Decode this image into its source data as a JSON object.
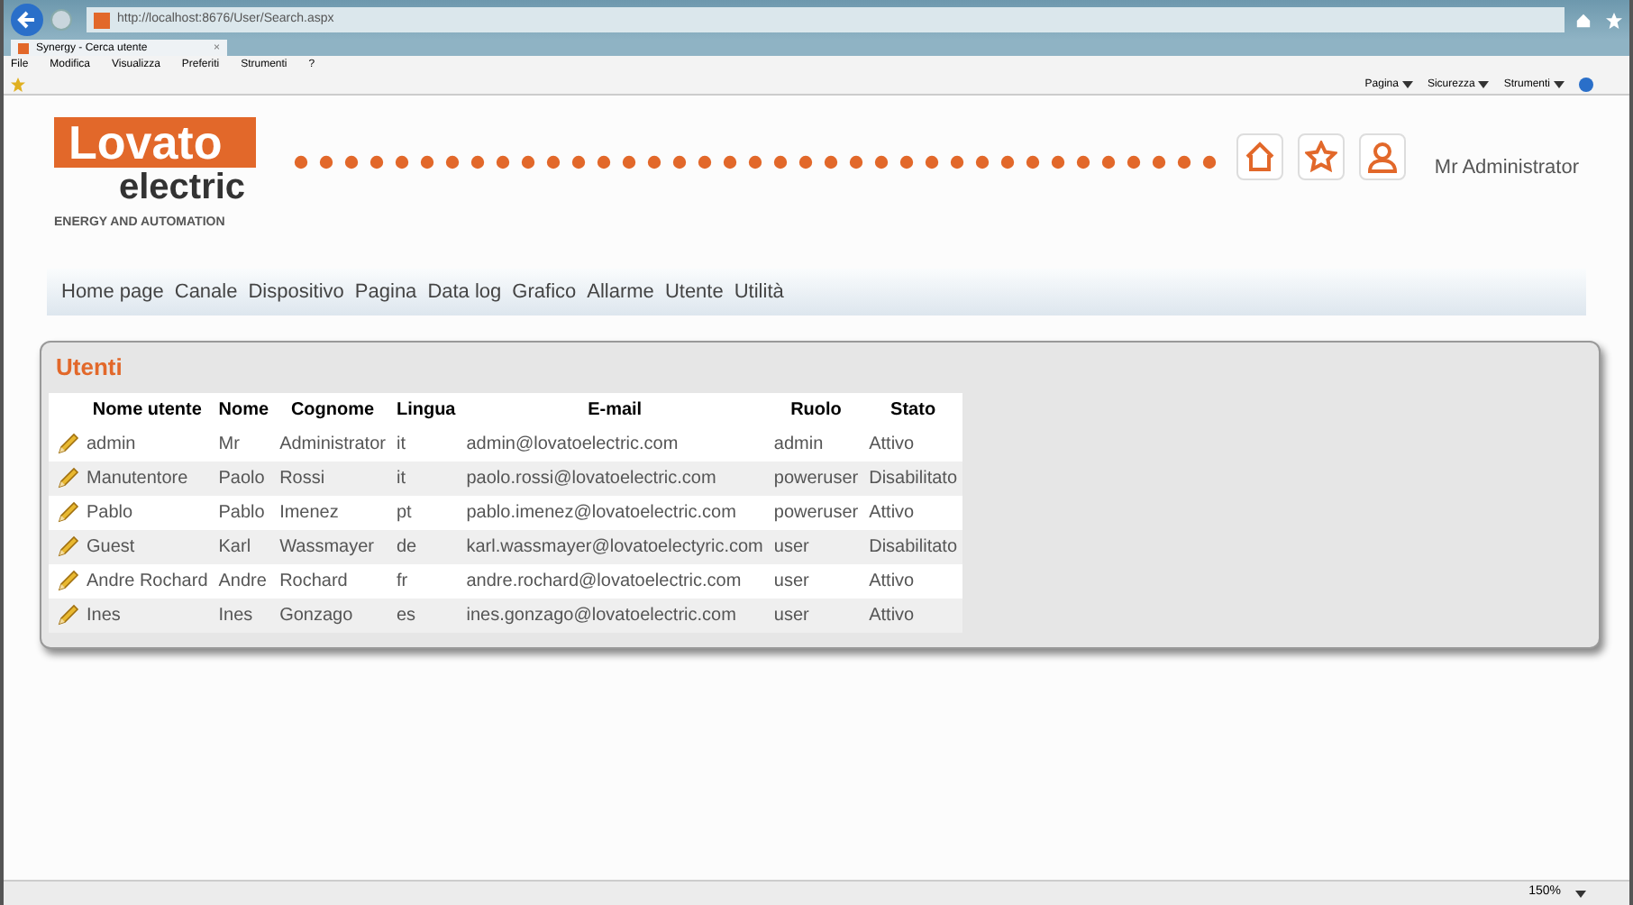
{
  "browser": {
    "address": "http://localhost:8676/User/Search.aspx",
    "tab_title": "Synergy - Cerca utente",
    "tab_close": "×",
    "menu": [
      "File",
      "Modifica",
      "Visualizza",
      "Preferiti",
      "Strumenti",
      "?"
    ],
    "command_bar": [
      "Pagina",
      "Sicurezza",
      "Strumenti"
    ],
    "zoom": "150%"
  },
  "header": {
    "logo_name": "Lovato",
    "logo_sub": "electric",
    "tagline": "ENERGY AND AUTOMATION",
    "user": "Mr Administrator"
  },
  "nav": [
    "Home page",
    "Canale",
    "Dispositivo",
    "Pagina",
    "Data log",
    "Grafico",
    "Allarme",
    "Utente",
    "Utilità"
  ],
  "panel": {
    "title": "Utenti",
    "columns": [
      "Nome utente",
      "Nome",
      "Cognome",
      "Lingua",
      "E-mail",
      "Ruolo",
      "Stato"
    ],
    "rows": [
      [
        "admin",
        "Mr",
        "Administrator",
        "it",
        "admin@lovatoelectric.com",
        "admin",
        "Attivo"
      ],
      [
        "Manutentore",
        "Paolo",
        "Rossi",
        "it",
        "paolo.rossi@lovatoelectric.com",
        "poweruser",
        "Disabilitato"
      ],
      [
        "Pablo",
        "Pablo",
        "Imenez",
        "pt",
        "pablo.imenez@lovatoelectric.com",
        "poweruser",
        "Attivo"
      ],
      [
        "Guest",
        "Karl",
        "Wassmayer",
        "de",
        "karl.wassmayer@lovatoelectyric.com",
        "user",
        "Disabilitato"
      ],
      [
        "Andre Rochard",
        "Andre",
        "Rochard",
        "fr",
        "andre.rochard@lovatoelectric.com",
        "user",
        "Attivo"
      ],
      [
        "Ines",
        "Ines",
        "Gonzago",
        "es",
        "ines.gonzago@lovatoelectric.com",
        "user",
        "Attivo"
      ]
    ]
  }
}
